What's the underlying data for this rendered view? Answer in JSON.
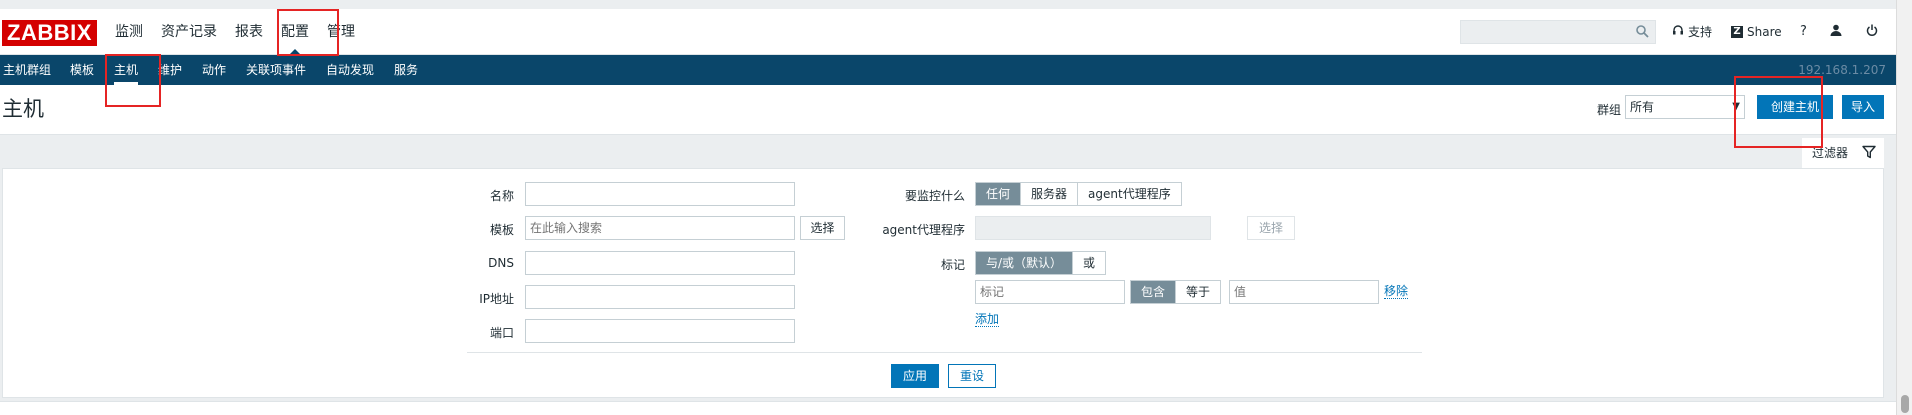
{
  "logo": "ZABBIX",
  "main_menu": [
    {
      "label": "监测"
    },
    {
      "label": "资产记录"
    },
    {
      "label": "报表"
    },
    {
      "label": "配置"
    },
    {
      "label": "管理"
    }
  ],
  "top_right": {
    "search_placeholder": "",
    "support_label": "支持",
    "share_z": "Z",
    "share_label": "Share",
    "help_label": "?"
  },
  "sub_menu": [
    {
      "label": "主机群组"
    },
    {
      "label": "模板"
    },
    {
      "label": "主机"
    },
    {
      "label": "维护"
    },
    {
      "label": "动作"
    },
    {
      "label": "关联项事件"
    },
    {
      "label": "自动发现"
    },
    {
      "label": "服务"
    }
  ],
  "server_ip": "192.168.1.207",
  "page": {
    "title": "主机",
    "group_label": "群组",
    "group_value": "所有",
    "create_host_button": "创建主机",
    "import_button": "导入"
  },
  "filter": {
    "tab_label": "过滤器",
    "name_label": "名称",
    "name_value": "",
    "template_label": "模板",
    "template_placeholder": "在此输入搜索",
    "select_button": "选择",
    "dns_label": "DNS",
    "dns_value": "",
    "ip_label": "IP地址",
    "ip_value": "",
    "port_label": "端口",
    "port_value": "",
    "monitored_by_label": "要监控什么",
    "monitored_by_options": [
      "任何",
      "服务器",
      "agent代理程序"
    ],
    "monitored_by_selected": "任何",
    "proxy_label": "agent代理程序",
    "proxy_select_button": "选择",
    "tags_label": "标记",
    "tags_mode_options": [
      "与/或（默认）",
      "或"
    ],
    "tags_mode_selected": "与/或（默认）",
    "tag_placeholder": "标记",
    "tag_operator_options": [
      "包含",
      "等于"
    ],
    "tag_operator_selected": "包含",
    "value_placeholder": "值",
    "remove_link": "移除",
    "add_link": "添加",
    "apply_button": "应用",
    "reset_button": "重设"
  },
  "colors": {
    "brand": "#d40000",
    "nav_dark": "#0a466a",
    "primary": "#0275b8",
    "annotation_red": "#e52424"
  }
}
